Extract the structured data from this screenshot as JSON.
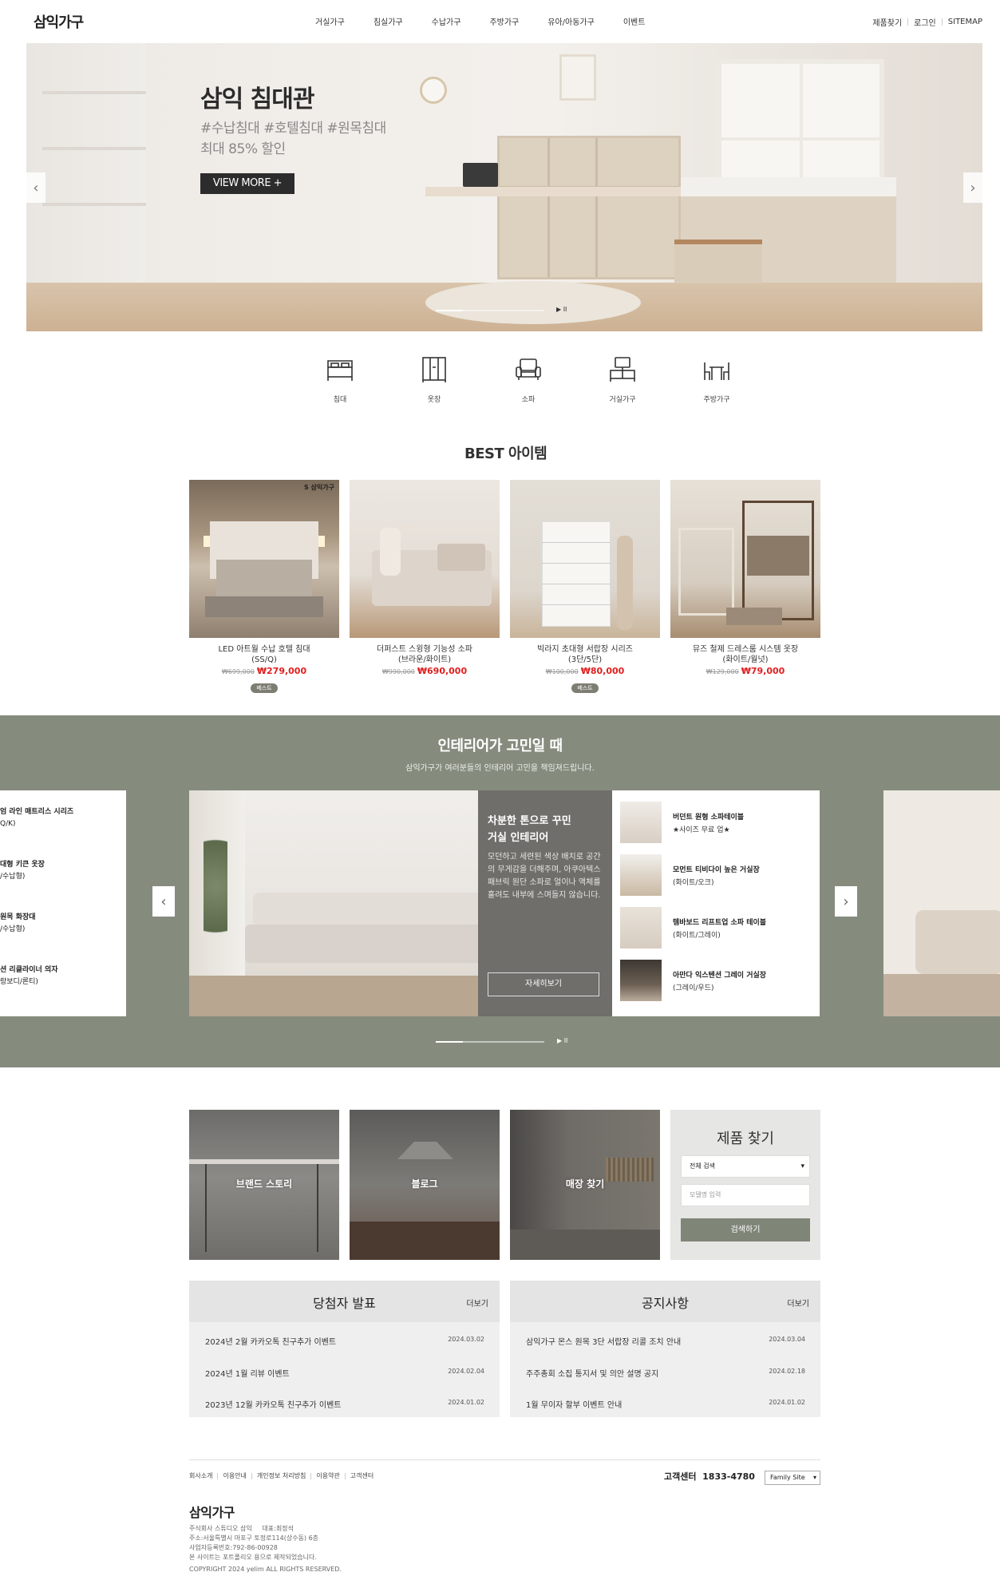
{
  "header": {
    "logo": "삼익가구",
    "nav": [
      "거실가구",
      "침실가구",
      "수납가구",
      "주방가구",
      "유아/아동가구",
      "이벤트"
    ],
    "util": [
      "제품찾기",
      "로그인",
      "SITEMAP"
    ]
  },
  "hero": {
    "title": "삼익 침대관",
    "sub1": "#수납침대 #호텔침대 #원목침대",
    "sub2": "최대 85% 할인",
    "button": "VIEW MORE +",
    "prev": "‹",
    "next": "›",
    "control": "▶ II"
  },
  "categories": [
    {
      "label": "침대",
      "icon": "bed-icon"
    },
    {
      "label": "옷장",
      "icon": "wardrobe-icon"
    },
    {
      "label": "소파",
      "icon": "sofa-icon"
    },
    {
      "label": "거실가구",
      "icon": "living-furniture-icon"
    },
    {
      "label": "주방가구",
      "icon": "dining-table-icon"
    }
  ],
  "best": {
    "title": "BEST 아이템",
    "items": [
      {
        "name": "LED 아트월 수납 호텔 침대",
        "sub": "(SS/Q)",
        "orig": "₩699,000",
        "price": "₩279,000",
        "badge": "베스트",
        "tag": "S 삼익가구"
      },
      {
        "name": "더퍼스트 스윙형 기능성 소파",
        "sub": "(브라운/화이트)",
        "orig": "₩990,000",
        "price": "₩690,000",
        "badge": ""
      },
      {
        "name": "빅라지 초대형 서랍장 시리즈",
        "sub": "(3단/5단)",
        "orig": "₩100,000",
        "price": "₩80,000",
        "badge": "베스트"
      },
      {
        "name": "뮤즈 철제 드레스룸 시스템 옷장",
        "sub": "(화이트/월넛)",
        "orig": "₩129,000",
        "price": "₩79,000",
        "badge": ""
      }
    ]
  },
  "interior": {
    "title": "인테리어가 고민일 때",
    "sub": "삼익가구가 여러분들의 인테리어 고민을 책임져드립니다.",
    "left_items": [
      {
        "name": "엄 라인 매트리스 시리즈",
        "sub": "Q/K)"
      },
      {
        "name": "대형 키큰 옷장",
        "sub": "/수납형)"
      },
      {
        "name": "원목 화장대",
        "sub": "/수납형)"
      },
      {
        "name": "션 리클라이너 의자",
        "sub": "랑보디/론티)"
      }
    ],
    "main_title1": "차분한 톤으로 꾸민",
    "main_title2": "거실 인테리어",
    "main_desc": "모던하고 세련된 색상 배치로 공간의 무게감을 더해주며, 아쿠아텍스 패브릭 원단 소파로 얼이나 액체를 흘려도 내부에 스며들지 않습니다.",
    "main_button": "자세히보기",
    "related": [
      {
        "name": "버던트 원형 소파테이블",
        "sub": "★사이즈 무료 업★"
      },
      {
        "name": "모먼트 티비다이 높은 거실장",
        "sub": "(화이트/오크)"
      },
      {
        "name": "템바보드 리프트업 소파 테이블",
        "sub": "(화이트/그레이)"
      },
      {
        "name": "아만다 익스텐션 그레이 거실장",
        "sub": "(그레이/우드)"
      }
    ],
    "prev": "‹",
    "next": "›",
    "control": "▶ II"
  },
  "quick": {
    "brand": "브랜드 스토리",
    "blog": "블로그",
    "store": "매장 찾기"
  },
  "find": {
    "title": "제품 찾기",
    "select": "전체 검색",
    "placeholder": "모델명 입력",
    "button": "검색하기"
  },
  "winners": {
    "title": "당첨자 발표",
    "more": "더보기",
    "items": [
      {
        "t": "2024년 2월 카카오톡 친구추가 이벤트",
        "d": "2024.03.02"
      },
      {
        "t": "2024년 1월 리뷰 이벤트",
        "d": "2024.02.04"
      },
      {
        "t": "2023년 12월 카카오톡 친구추가 이벤트",
        "d": "2024.01.02"
      }
    ]
  },
  "notice": {
    "title": "공지사항",
    "more": "더보기",
    "items": [
      {
        "t": "삼익가구 몬스 원목 3단 서랍장 리콜 조치 안내",
        "d": "2024.03.04"
      },
      {
        "t": "주주총회 소집 통지서 및 의안 설명 공지",
        "d": "2024.02.18"
      },
      {
        "t": "1월 무이자 할부 이벤트 안내",
        "d": "2024.01.02"
      }
    ]
  },
  "footer": {
    "links": [
      "회사소개",
      "이용안내",
      "개인정보 처리방침",
      "이용약관",
      "고객센터"
    ],
    "cs_label": "고객센터",
    "cs_number": "1833-4780",
    "family": "Family Site",
    "logo": "삼익가구",
    "info1": "주식회사 스튜디오 삼익     대표:최정석",
    "info2": "주소:서울특별시 마포구 토정로114(상수동) 6층",
    "info3": "사업자등록번호:792-86-00928",
    "info4": "본 사이트는 포트폴리오 용으로 제작되었습니다.",
    "copyright": "COPYRIGHT 2024 yelim ALL RIGHTS RESERVED."
  }
}
